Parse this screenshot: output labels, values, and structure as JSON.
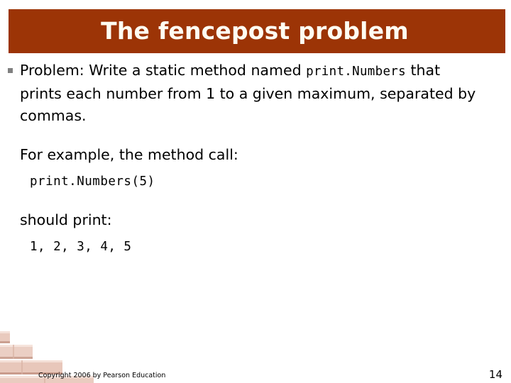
{
  "slide": {
    "title": "The fencepost problem",
    "banner_color": "#9C3406",
    "title_color": "#FFFDF2",
    "background_color": "#FFFFFF"
  },
  "content": {
    "bullet": {
      "marker": "square-bullet",
      "marker_color": "#808080",
      "text_before_code": "Problem: Write a static method named ",
      "inline_code": "print.Numbers",
      "text_after_code": " that prints each number from 1 to a given maximum, separated by commas."
    },
    "example_intro": "For example, the method call:",
    "example_code": "print.Numbers(5)",
    "result_intro": "should print:",
    "result_code": "1, 2, 3, 4, 5"
  },
  "decoration": {
    "name": "brick-stair-graphic",
    "brick_color": "#E7C4B8",
    "brick_shadow": "#C99C8C",
    "brick_light": "#F3DDD4"
  },
  "footer": {
    "copyright": "Copyright 2006 by Pearson Education",
    "page_number": "14"
  }
}
